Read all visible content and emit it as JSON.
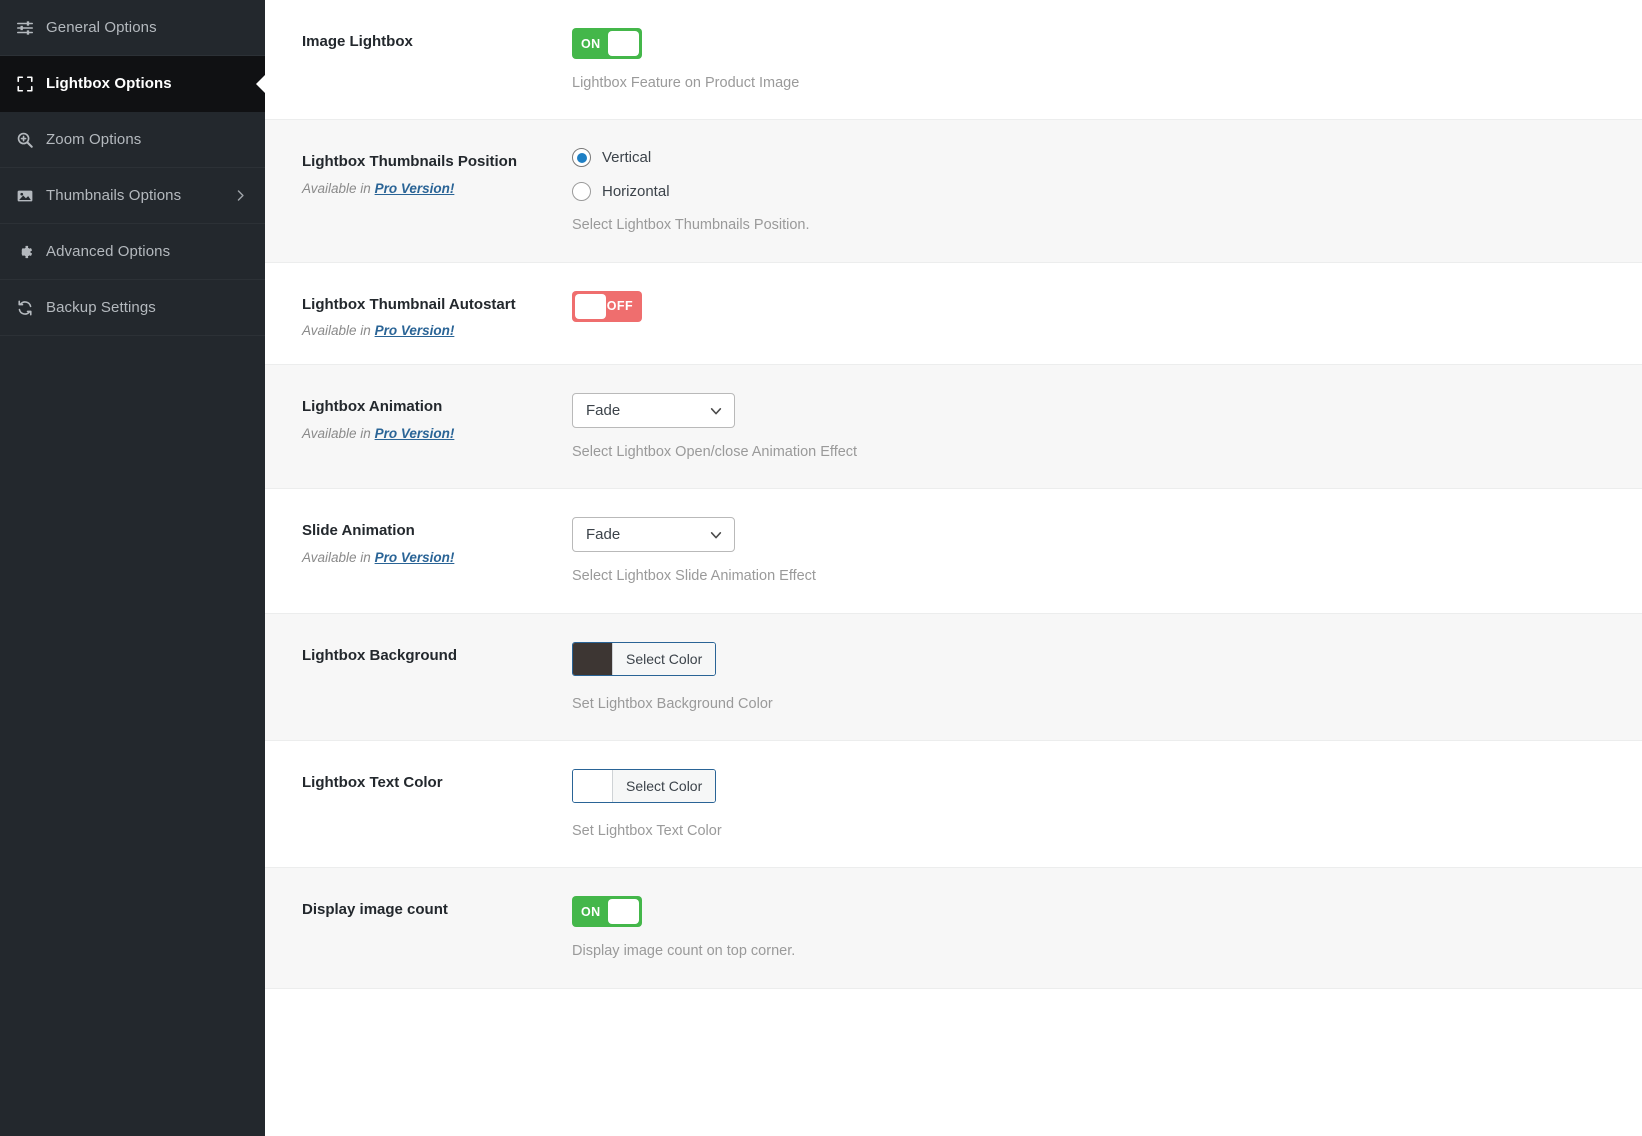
{
  "sidebar": {
    "items": [
      {
        "label": "General Options",
        "icon": "sliders-icon",
        "active": false,
        "chevron": false
      },
      {
        "label": "Lightbox Options",
        "icon": "expand-icon",
        "active": true,
        "chevron": false
      },
      {
        "label": "Zoom Options",
        "icon": "magnifier-plus-icon",
        "active": false,
        "chevron": false
      },
      {
        "label": "Thumbnails Options",
        "icon": "image-icon",
        "active": false,
        "chevron": true
      },
      {
        "label": "Advanced Options",
        "icon": "gear-icon",
        "active": false,
        "chevron": false
      },
      {
        "label": "Backup Settings",
        "icon": "refresh-icon",
        "active": false,
        "chevron": false
      }
    ]
  },
  "colors": {
    "sidebar_bg": "#23282d",
    "sidebar_active_bg": "#101113",
    "toggle_on": "#44b74a",
    "toggle_off": "#ef6e6e",
    "radio_accent": "#1e7fc4",
    "pro_link": "#2a6496",
    "lightbox_background_swatch": "#3d3633",
    "lightbox_text_swatch": "#ffffff"
  },
  "common": {
    "available_in": "Available in",
    "pro_version": "Pro Version!",
    "select_color": "Select Color",
    "on": "ON",
    "off": "OFF"
  },
  "rows": [
    {
      "title": "Image Lightbox",
      "sub": null,
      "type": "toggle",
      "value": "ON",
      "help": "Lightbox Feature on Product Image",
      "alt": false
    },
    {
      "title": "Lightbox Thumbnails Position",
      "sub": true,
      "type": "radio",
      "options": [
        {
          "label": "Vertical",
          "checked": true
        },
        {
          "label": "Horizontal",
          "checked": false
        }
      ],
      "help": "Select Lightbox Thumbnails Position.",
      "alt": true
    },
    {
      "title": "Lightbox Thumbnail Autostart",
      "sub": true,
      "type": "toggle",
      "value": "OFF",
      "help": "",
      "alt": false
    },
    {
      "title": "Lightbox Animation",
      "sub": true,
      "type": "select",
      "value": "Fade",
      "help": "Select Lightbox Open/close Animation Effect",
      "alt": true
    },
    {
      "title": "Slide Animation",
      "sub": true,
      "type": "select",
      "value": "Fade",
      "help": "Select Lightbox Slide Animation Effect",
      "alt": false
    },
    {
      "title": "Lightbox Background",
      "sub": null,
      "type": "color",
      "swatch": "#3d3633",
      "help": "Set Lightbox Background Color",
      "alt": true
    },
    {
      "title": "Lightbox Text Color",
      "sub": null,
      "type": "color",
      "swatch": "#ffffff",
      "help": "Set Lightbox Text Color",
      "alt": false
    },
    {
      "title": "Display image count",
      "sub": null,
      "type": "toggle",
      "value": "ON",
      "help": "Display image count on top corner.",
      "alt": true
    }
  ]
}
